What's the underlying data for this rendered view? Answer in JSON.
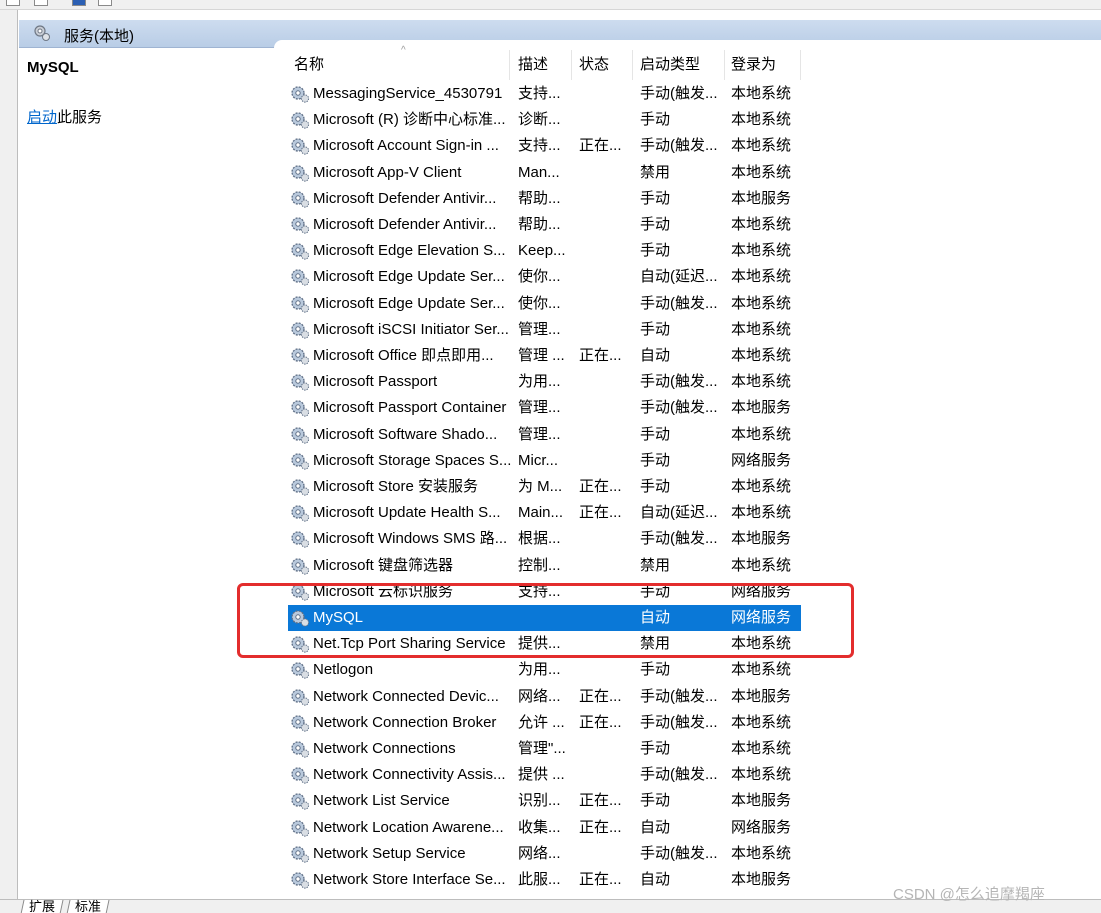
{
  "header": {
    "title": "服务(本地)",
    "icon": "services-icon"
  },
  "details": {
    "service_name": "MySQL",
    "start_link": "启动",
    "start_suffix": "此服务"
  },
  "columns": {
    "name": "名称",
    "description": "描述",
    "status": "状态",
    "startup_type": "启动类型",
    "logon_as": "登录为"
  },
  "rows": [
    {
      "name": "MessagingService_4530791",
      "description": "支持...",
      "status": "",
      "startup_type": "手动(触发...",
      "logon_as": "本地系统"
    },
    {
      "name": "Microsoft (R) 诊断中心标准...",
      "description": "诊断...",
      "status": "",
      "startup_type": "手动",
      "logon_as": "本地系统"
    },
    {
      "name": "Microsoft Account Sign-in ...",
      "description": "支持...",
      "status": "正在...",
      "startup_type": "手动(触发...",
      "logon_as": "本地系统"
    },
    {
      "name": "Microsoft App-V Client",
      "description": "Man...",
      "status": "",
      "startup_type": "禁用",
      "logon_as": "本地系统"
    },
    {
      "name": "Microsoft Defender Antivir...",
      "description": "帮助...",
      "status": "",
      "startup_type": "手动",
      "logon_as": "本地服务"
    },
    {
      "name": "Microsoft Defender Antivir...",
      "description": "帮助...",
      "status": "",
      "startup_type": "手动",
      "logon_as": "本地系统"
    },
    {
      "name": "Microsoft Edge Elevation S...",
      "description": "Keep...",
      "status": "",
      "startup_type": "手动",
      "logon_as": "本地系统"
    },
    {
      "name": "Microsoft Edge Update Ser...",
      "description": "使你...",
      "status": "",
      "startup_type": "自动(延迟...",
      "logon_as": "本地系统"
    },
    {
      "name": "Microsoft Edge Update Ser...",
      "description": "使你...",
      "status": "",
      "startup_type": "手动(触发...",
      "logon_as": "本地系统"
    },
    {
      "name": "Microsoft iSCSI Initiator Ser...",
      "description": "管理...",
      "status": "",
      "startup_type": "手动",
      "logon_as": "本地系统"
    },
    {
      "name": "Microsoft Office 即点即用...",
      "description": "管理 ...",
      "status": "正在...",
      "startup_type": "自动",
      "logon_as": "本地系统"
    },
    {
      "name": "Microsoft Passport",
      "description": "为用...",
      "status": "",
      "startup_type": "手动(触发...",
      "logon_as": "本地系统"
    },
    {
      "name": "Microsoft Passport Container",
      "description": "管理...",
      "status": "",
      "startup_type": "手动(触发...",
      "logon_as": "本地服务"
    },
    {
      "name": "Microsoft Software Shado...",
      "description": "管理...",
      "status": "",
      "startup_type": "手动",
      "logon_as": "本地系统"
    },
    {
      "name": "Microsoft Storage Spaces S...",
      "description": "Micr...",
      "status": "",
      "startup_type": "手动",
      "logon_as": "网络服务"
    },
    {
      "name": "Microsoft Store 安装服务",
      "description": "为 M...",
      "status": "正在...",
      "startup_type": "手动",
      "logon_as": "本地系统"
    },
    {
      "name": "Microsoft Update Health S...",
      "description": "Main...",
      "status": "正在...",
      "startup_type": "自动(延迟...",
      "logon_as": "本地系统"
    },
    {
      "name": "Microsoft Windows SMS 路...",
      "description": "根据...",
      "status": "",
      "startup_type": "手动(触发...",
      "logon_as": "本地服务"
    },
    {
      "name": "Microsoft 键盘筛选器",
      "description": "控制...",
      "status": "",
      "startup_type": "禁用",
      "logon_as": "本地系统"
    },
    {
      "name": "Microsoft 云标识服务",
      "description": "支持...",
      "status": "",
      "startup_type": "手动",
      "logon_as": "网络服务"
    },
    {
      "name": "MySQL",
      "description": "",
      "status": "",
      "startup_type": "自动",
      "logon_as": "网络服务",
      "selected": true
    },
    {
      "name": "Net.Tcp Port Sharing Service",
      "description": "提供...",
      "status": "",
      "startup_type": "禁用",
      "logon_as": "本地系统"
    },
    {
      "name": "Netlogon",
      "description": "为用...",
      "status": "",
      "startup_type": "手动",
      "logon_as": "本地系统"
    },
    {
      "name": "Network Connected Devic...",
      "description": "网络...",
      "status": "正在...",
      "startup_type": "手动(触发...",
      "logon_as": "本地服务"
    },
    {
      "name": "Network Connection Broker",
      "description": "允许 ...",
      "status": "正在...",
      "startup_type": "手动(触发...",
      "logon_as": "本地系统"
    },
    {
      "name": "Network Connections",
      "description": "管理\"...",
      "status": "",
      "startup_type": "手动",
      "logon_as": "本地系统"
    },
    {
      "name": "Network Connectivity Assis...",
      "description": "提供 ...",
      "status": "",
      "startup_type": "手动(触发...",
      "logon_as": "本地系统"
    },
    {
      "name": "Network List Service",
      "description": "识别...",
      "status": "正在...",
      "startup_type": "手动",
      "logon_as": "本地服务"
    },
    {
      "name": "Network Location Awarene...",
      "description": "收集...",
      "status": "正在...",
      "startup_type": "自动",
      "logon_as": "网络服务"
    },
    {
      "name": "Network Setup Service",
      "description": "网络...",
      "status": "",
      "startup_type": "手动(触发...",
      "logon_as": "本地系统"
    },
    {
      "name": "Network Store Interface Se...",
      "description": "此服...",
      "status": "正在...",
      "startup_type": "自动",
      "logon_as": "本地服务"
    }
  ],
  "tabs": {
    "extended": "扩展",
    "standard": "标准"
  },
  "watermark": "CSDN @怎么追摩羯座",
  "colors": {
    "selection": "#0a78d7",
    "highlight_box": "#e32d2d",
    "link": "#0066cc"
  }
}
